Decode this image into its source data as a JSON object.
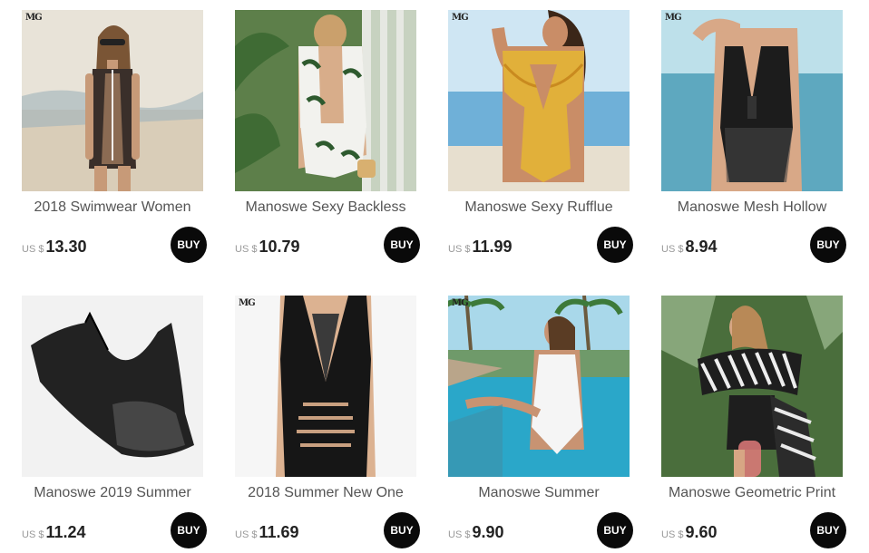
{
  "currency_label": "US $",
  "buy_label": "BUY",
  "brand_mark": "MG",
  "products": [
    {
      "title": "2018 Swimwear Women",
      "price": "13.30",
      "colors": {
        "bg": "#d9cdb8",
        "sky": "#e8e3d8",
        "swim": "#3a2f2a",
        "skin": "#c79a78"
      }
    },
    {
      "title": "Manoswe Sexy Backless",
      "price": "10.79",
      "colors": {
        "bg": "#5d7f4a",
        "sky": "#c7d2c0",
        "swim": "#f2f2ee",
        "skin": "#d8ad8a"
      }
    },
    {
      "title": "Manoswe Sexy Rufflue",
      "price": "11.99",
      "colors": {
        "bg": "#6fb0d8",
        "sky": "#cfe6f3",
        "swim": "#e1b03a",
        "skin": "#c98d67"
      }
    },
    {
      "title": "Manoswe Mesh Hollow",
      "price": "8.94",
      "colors": {
        "bg": "#5ea8bf",
        "sky": "#bde0ea",
        "swim": "#1c1c1c",
        "skin": "#d8a887"
      }
    },
    {
      "title": "Manoswe 2019 Summer",
      "price": "11.24",
      "colors": {
        "bg": "#f2f2f2",
        "sky": "#f6f6f6",
        "swim": "#222222",
        "skin": "#f2f2f2"
      }
    },
    {
      "title": "2018 Summer New One",
      "price": "11.69",
      "colors": {
        "bg": "#f6f6f6",
        "sky": "#ffffff",
        "swim": "#161616",
        "skin": "#dcb291"
      }
    },
    {
      "title": "Manoswe Summer",
      "price": "9.90",
      "colors": {
        "bg": "#2aa7c9",
        "sky": "#a9d8ea",
        "swim": "#f5f5f5",
        "skin": "#c89372"
      }
    },
    {
      "title": "Manoswe Geometric Print",
      "price": "9.60",
      "colors": {
        "bg": "#4a6e3c",
        "sky": "#87a67a",
        "swim": "#1e1e1e",
        "skin": "#d7a684"
      }
    }
  ]
}
